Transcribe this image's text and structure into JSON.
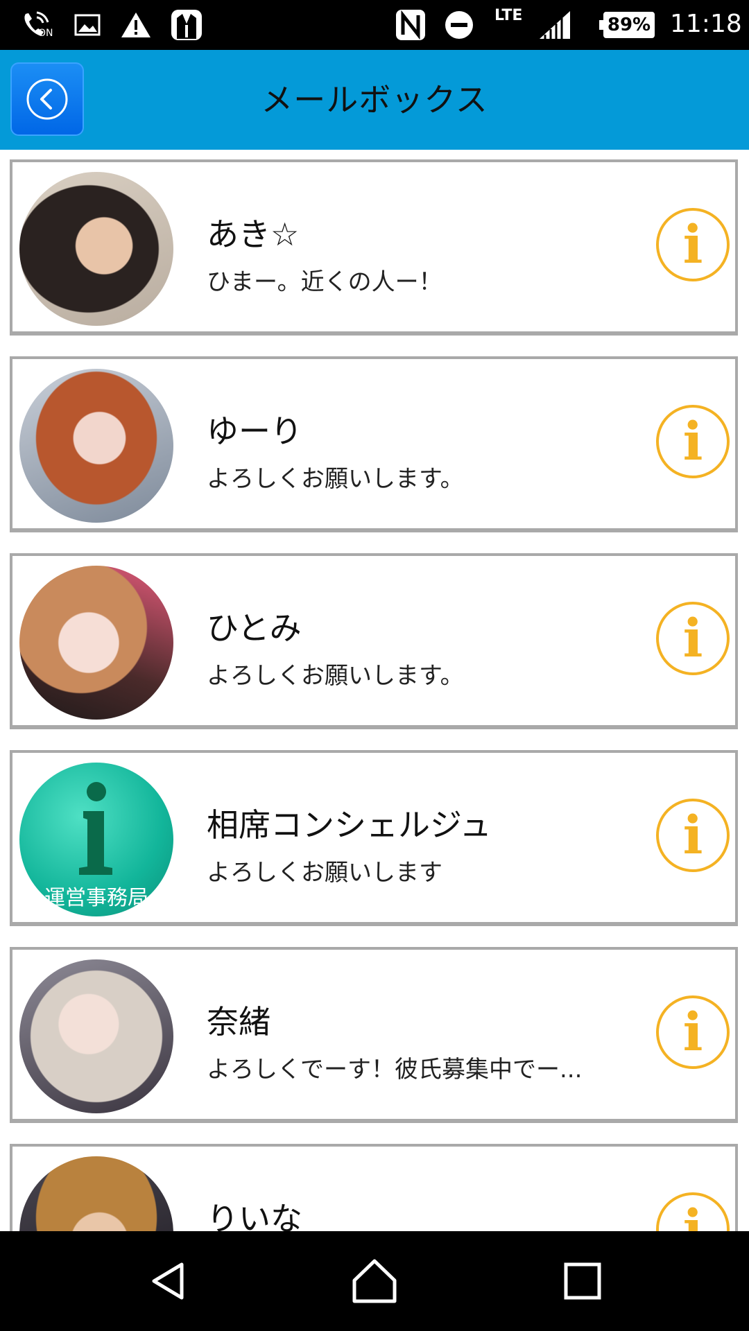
{
  "status_bar": {
    "call_on_label": "ON",
    "network_type": "LTE",
    "battery_percent": "89%",
    "battery_level": 0.89,
    "time": "11:18",
    "icons": [
      "wifi-calling-icon",
      "image-icon",
      "warning-icon",
      "tuxedo-app-icon",
      "nfc-icon",
      "do-not-disturb-icon",
      "signal-icon",
      "battery-icon"
    ]
  },
  "header": {
    "title": "メールボックス",
    "back_icon": "chevron-left-icon"
  },
  "messages": [
    {
      "name": "あき☆",
      "preview": "ひまー。近くの人ー！",
      "avatar": "photo"
    },
    {
      "name": "ゆーり",
      "preview": "よろしくお願いします。",
      "avatar": "photo"
    },
    {
      "name": "ひとみ",
      "preview": "よろしくお願いします。",
      "avatar": "photo"
    },
    {
      "name": "相席コンシェルジュ",
      "preview": "よろしくお願いします",
      "avatar": "info-logo",
      "avatar_text": "運営事務局"
    },
    {
      "name": "奈緒",
      "preview": "よろしくでーす！彼氏募集中でー...",
      "avatar": "photo"
    },
    {
      "name": "りいな",
      "preview": "",
      "avatar": "photo"
    }
  ],
  "info_button": {
    "glyph": "i",
    "icon": "info-icon"
  },
  "nav_bar": {
    "items": [
      "back-icon",
      "home-icon",
      "recents-icon"
    ]
  },
  "colors": {
    "header_bg": "#049ad8",
    "back_button": "#0a7cf0",
    "info_accent": "#f4b223",
    "card_border": "#a9a9a9"
  }
}
